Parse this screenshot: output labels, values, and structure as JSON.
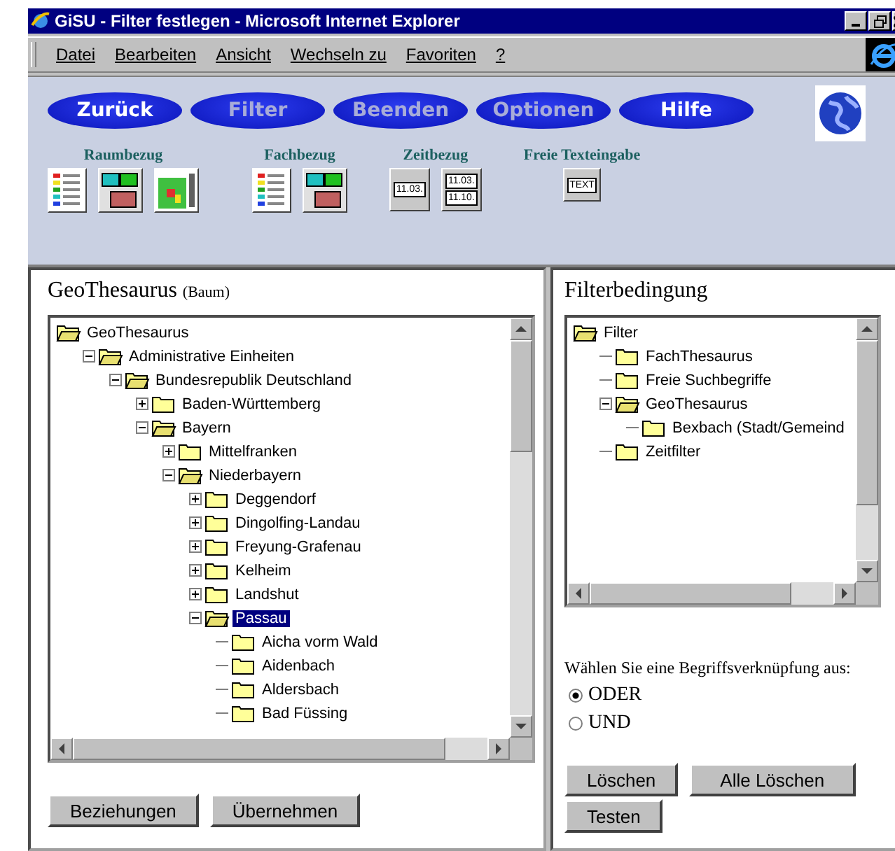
{
  "window": {
    "title": "GiSU - Filter festlegen - Microsoft Internet Explorer"
  },
  "menu": [
    "Datei",
    "Bearbeiten",
    "Ansicht",
    "Wechseln zu",
    "Favoriten",
    "?"
  ],
  "nav_buttons": [
    {
      "label": "Zurück",
      "disabled": false
    },
    {
      "label": "Filter",
      "disabled": true
    },
    {
      "label": "Beenden",
      "disabled": true
    },
    {
      "label": "Optionen",
      "disabled": true
    },
    {
      "label": "Hilfe",
      "disabled": false
    }
  ],
  "tool_groups": [
    {
      "label": "Raumbezug",
      "tools": [
        {
          "kind": "legend"
        },
        {
          "kind": "screens"
        },
        {
          "kind": "grid"
        }
      ]
    },
    {
      "label": "Fachbezug",
      "tools": [
        {
          "kind": "legend"
        },
        {
          "kind": "screens"
        }
      ]
    },
    {
      "label": "Zeitbezug",
      "tools": [
        {
          "kind": "date",
          "texts": [
            "11.03."
          ]
        },
        {
          "kind": "date",
          "texts": [
            "11.03.",
            "11.10."
          ]
        }
      ]
    },
    {
      "label": "Freie Texteingabe",
      "tools": [
        {
          "kind": "text",
          "texts": [
            "TEXT"
          ]
        }
      ]
    }
  ],
  "left_frame": {
    "title": "GeoThesaurus",
    "subtitle": "(Baum)",
    "tree": [
      {
        "label": "GeoThesaurus",
        "selected": false,
        "children": [
          {
            "label": "Administrative Einheiten",
            "expanded": true,
            "selected": false,
            "children": [
              {
                "label": "Bundesrepublik Deutschland",
                "expanded": true,
                "selected": false,
                "children": [
                  {
                    "label": "Baden-Württemberg",
                    "expanded": false,
                    "selected": false
                  },
                  {
                    "label": "Bayern",
                    "expanded": true,
                    "selected": false,
                    "children": [
                      {
                        "label": "Mittelfranken",
                        "expanded": false,
                        "selected": false
                      },
                      {
                        "label": "Niederbayern",
                        "expanded": true,
                        "selected": false,
                        "children": [
                          {
                            "label": "Deggendorf",
                            "expanded": false,
                            "selected": false
                          },
                          {
                            "label": "Dingolfing-Landau",
                            "expanded": false,
                            "selected": false
                          },
                          {
                            "label": "Freyung-Grafenau",
                            "expanded": false,
                            "selected": false
                          },
                          {
                            "label": "Kelheim",
                            "expanded": false,
                            "selected": false
                          },
                          {
                            "label": "Landshut",
                            "expanded": false,
                            "selected": false
                          },
                          {
                            "label": "Passau",
                            "expanded": true,
                            "selected": true,
                            "children": [
                              {
                                "label": "Aicha vorm Wald",
                                "selected": false
                              },
                              {
                                "label": "Aidenbach",
                                "selected": false
                              },
                              {
                                "label": "Aldersbach",
                                "selected": false
                              },
                              {
                                "label": "Bad Füssing",
                                "selected": false
                              }
                            ]
                          }
                        ]
                      }
                    ]
                  }
                ]
              }
            ]
          }
        ]
      }
    ],
    "buttons": [
      "Beziehungen",
      "Übernehmen"
    ]
  },
  "right_frame": {
    "title": "Filterbedingung",
    "tree": [
      {
        "label": "Filter",
        "selected": false,
        "children": [
          {
            "label": "FachThesaurus",
            "selected": false
          },
          {
            "label": "Freie Suchbegriffe",
            "selected": false
          },
          {
            "label": "GeoThesaurus",
            "expanded": true,
            "selected": false,
            "children": [
              {
                "label": "Bexbach (Stadt/Gemeind",
                "selected": false
              }
            ]
          },
          {
            "label": "Zeitfilter",
            "selected": false
          }
        ]
      }
    ],
    "prompt": "Wählen Sie eine Begriffsverknüpfung aus:",
    "options": [
      {
        "label": "ODER",
        "selected": true
      },
      {
        "label": "UND",
        "selected": false
      }
    ],
    "buttons": [
      "Löschen",
      "Alle Löschen",
      "Testen"
    ]
  }
}
